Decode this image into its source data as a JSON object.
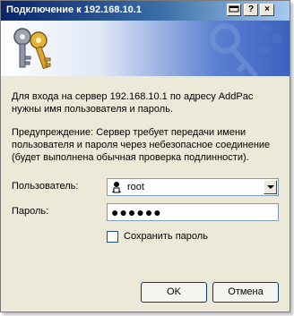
{
  "window": {
    "title": "Подключение к 192.168.10.1",
    "controls": {
      "help": "?",
      "close": "×"
    }
  },
  "dialog": {
    "message": "Для входа на сервер 192.168.10.1 по адресу AddPac нужны имя пользователя и пароль.",
    "warning": "Предупреждение: Сервер требует передачи имени пользователя и пароля через небезопасное соединение (будет выполнена обычная проверка подлинности).",
    "user_label": "Пользователь:",
    "username": "root",
    "password_label": "Пароль:",
    "password_mask": "●●●●●●",
    "remember_label": "Сохранить пароль",
    "remember_checked": false,
    "ok_label": "OK",
    "cancel_label": "Отмена"
  },
  "icons": [
    "keys-icon",
    "user-icon",
    "window-menu-icon",
    "help-icon",
    "close-icon",
    "chevron-down-icon"
  ],
  "colors": {
    "titlebar": "#0a246a",
    "banner": "#3d62be",
    "dialog_bg": "#ece9d8"
  }
}
